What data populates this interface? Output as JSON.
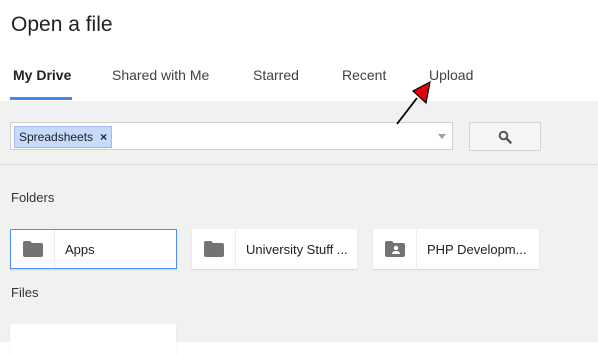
{
  "title": "Open a file",
  "tabs": [
    {
      "label": "My Drive",
      "active": true
    },
    {
      "label": "Shared with Me",
      "active": false
    },
    {
      "label": "Starred",
      "active": false
    },
    {
      "label": "Recent",
      "active": false
    },
    {
      "label": "Upload",
      "active": false
    }
  ],
  "search": {
    "chip_label": "Spreadsheets",
    "chip_remove": "×",
    "value": "",
    "button_icon": "search-icon"
  },
  "sections": {
    "folders_label": "Folders",
    "files_label": "Files"
  },
  "folders": [
    {
      "name": "Apps",
      "icon": "folder-icon",
      "selected": true
    },
    {
      "name": "University Stuff ...",
      "icon": "folder-icon",
      "selected": false
    },
    {
      "name": "PHP Developm...",
      "icon": "shared-folder-icon",
      "selected": false
    }
  ],
  "colors": {
    "accent": "#4285f4",
    "chip_bg": "#c6dafc",
    "annotation_arrow": "#e3000f"
  }
}
